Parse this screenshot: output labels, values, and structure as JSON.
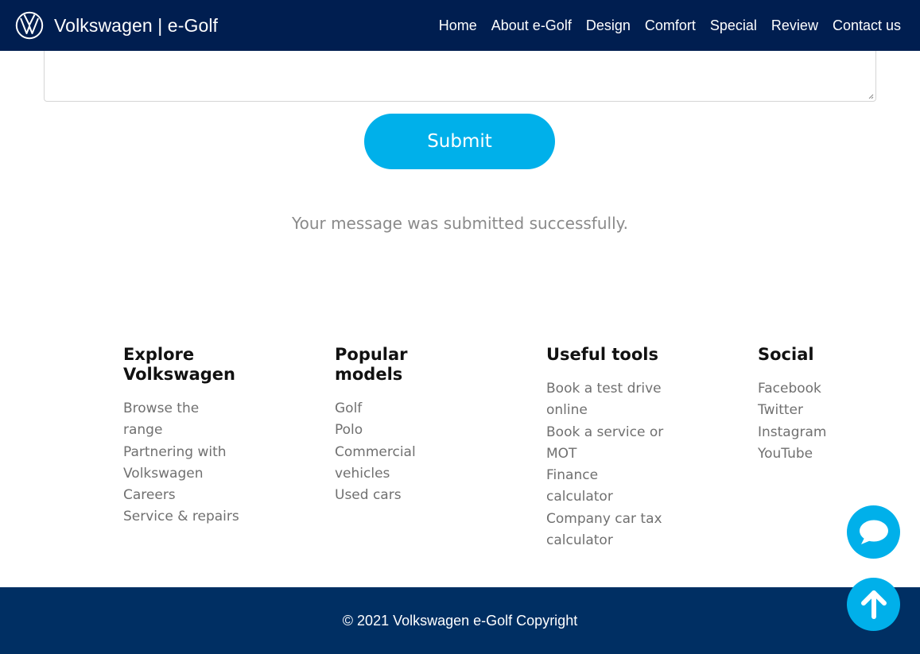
{
  "brand": {
    "name": "Volkswagen | e-Golf",
    "logo_icon": "vw-logo-icon"
  },
  "nav": {
    "links": [
      "Home",
      "About e-Golf",
      "Design",
      "Comfort",
      "Special",
      "Review",
      "Contact us"
    ]
  },
  "form": {
    "message_value": "",
    "submit_label": "Submit",
    "success_message": "Your message was submitted successfully."
  },
  "footer": {
    "columns": [
      {
        "heading": "Explore Volkswagen",
        "items": [
          "Browse the range",
          "Partnering with Volkswagen",
          "Careers",
          "Service & repairs"
        ]
      },
      {
        "heading": "Popular models",
        "items": [
          "Golf",
          "Polo",
          "Commercial vehicles",
          "Used cars"
        ]
      },
      {
        "heading": "Useful tools",
        "items": [
          "Book a test drive online",
          "Book a service or MOT",
          "Finance calculator",
          "Company car tax calculator"
        ]
      },
      {
        "heading": "Social",
        "items": [
          "Facebook",
          "Twitter",
          "Instagram",
          "YouTube"
        ]
      }
    ],
    "copyright": "© 2021 Volkswagen e-Golf Copyright"
  },
  "fabs": {
    "chat_icon": "chat-bubble-icon",
    "top_icon": "arrow-up-icon"
  },
  "colors": {
    "nav_bg": "#001e50",
    "accent": "#00b0ea",
    "footer_bar": "#002f63"
  }
}
